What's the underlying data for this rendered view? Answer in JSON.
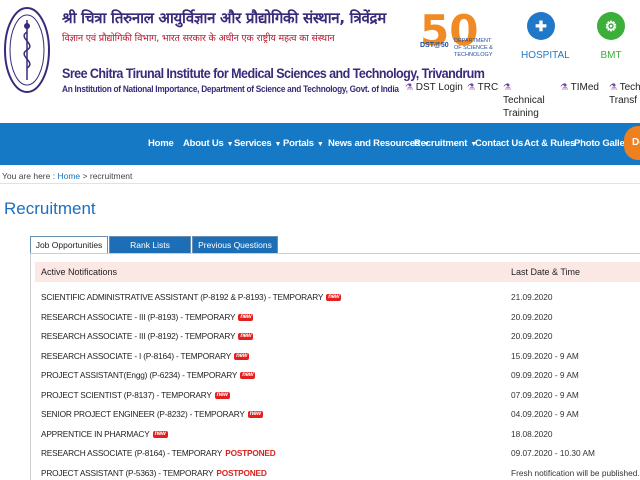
{
  "header": {
    "hindi_name": "श्री चित्रा तिरुनाल आयुर्विज्ञान और प्रौद्योगिकी संस्थान, त्रिवेंद्रम",
    "hindi_subtitle": "विज्ञान एवं प्रौद्योगिकी विभाग, भारत सरकार के अधीन एक राष्ट्रीय महत्व का संस्थान",
    "english_name": "Sree Chitra Tirunal Institute for Medical Sciences and Technology, Trivandrum",
    "english_subtitle": "An Institution of National Importance, Department of Science and Technology, Govt. of India",
    "dst_badge": "50",
    "dst_label": "DST@50",
    "dst_text": "DEPARTMENT OF SCIENCE & TECHNOLOGY",
    "hospital_label": "HOSPITAL",
    "bmt_label": "BMT",
    "quick_links": [
      {
        "label": "DST Login"
      },
      {
        "label": "TRC"
      },
      {
        "label": "Technical Training"
      },
      {
        "label": "TIMed"
      },
      {
        "label": "Techn Transf"
      }
    ]
  },
  "nav": {
    "items": [
      {
        "label": "Home",
        "caret": false
      },
      {
        "label": "About Us",
        "caret": true
      },
      {
        "label": "Services",
        "caret": true
      },
      {
        "label": "Portals",
        "caret": true
      },
      {
        "label": "News and Resources",
        "caret": true
      },
      {
        "label": "Recruitment",
        "caret": true
      },
      {
        "label": "Contact Us",
        "caret": false
      },
      {
        "label": "Act & Rules",
        "caret": false
      },
      {
        "label": "Photo Gallery",
        "caret": false
      }
    ],
    "orange_label": "Do"
  },
  "breadcrumb": {
    "prefix": "You are here :",
    "home": "Home",
    "separator": ">",
    "current": "recruitment"
  },
  "page": {
    "title": "Recruitment"
  },
  "tabs": [
    {
      "label": "Job Opportunities",
      "active": true
    },
    {
      "label": "Rank Lists",
      "active": false
    },
    {
      "label": "Previous Questions",
      "active": false
    }
  ],
  "table": {
    "headers": {
      "notification": "Active Notifications",
      "date": "Last Date & Time"
    },
    "new_badge": "new",
    "rows": [
      {
        "title": "SCIENTIFIC ADMINISTRATIVE ASSISTANT (P-8192 & P-8193) - TEMPORARY",
        "new": true,
        "postponed": "",
        "date": "21.09.2020"
      },
      {
        "title": "RESEARCH ASSOCIATE - III (P-8193) - TEMPORARY",
        "new": true,
        "postponed": "",
        "date": "20.09.2020"
      },
      {
        "title": "RESEARCH ASSOCIATE - III (P-8192) - TEMPORARY",
        "new": true,
        "postponed": "",
        "date": "20.09.2020"
      },
      {
        "title": "RESEARCH ASSOCIATE - I (P-8164) - TEMPORARY",
        "new": true,
        "postponed": "",
        "date": "15.09.2020 - 9 AM"
      },
      {
        "title": "PROJECT ASSISTANT(Engg) (P-6234) - TEMPORARY",
        "new": true,
        "postponed": "",
        "date": "09.09.2020 - 9 AM"
      },
      {
        "title": "PROJECT SCIENTIST (P-8137) - TEMPORARY",
        "new": true,
        "postponed": "",
        "date": "07.09.2020 - 9 AM"
      },
      {
        "title": "SENIOR PROJECT ENGINEER (P-8232) - TEMPORARY",
        "new": true,
        "postponed": "",
        "date": "04.09.2020 - 9 AM"
      },
      {
        "title": "APPRENTICE IN PHARMACY",
        "new": true,
        "postponed": "",
        "date": "18.08.2020"
      },
      {
        "title": "RESEARCH ASSOCIATE (P-8164) - TEMPORARY",
        "new": false,
        "postponed": "POSTPONED",
        "date": "09.07.2020 - 10.30 AM"
      },
      {
        "title": "PROJECT ASSISTANT (P-5363) - TEMPORARY",
        "new": false,
        "postponed": "POSTPONED",
        "date": "Fresh notification will be published."
      }
    ]
  },
  "colors": {
    "nav_blue": "#1679c6",
    "title_blue": "#1a6fbf",
    "brand_purple": "#3b2a7a",
    "hindi_red": "#b3152c",
    "accent_orange": "#f07f1f",
    "header_row_pink": "#fbe8e4",
    "badge_red": "#e4201f"
  }
}
